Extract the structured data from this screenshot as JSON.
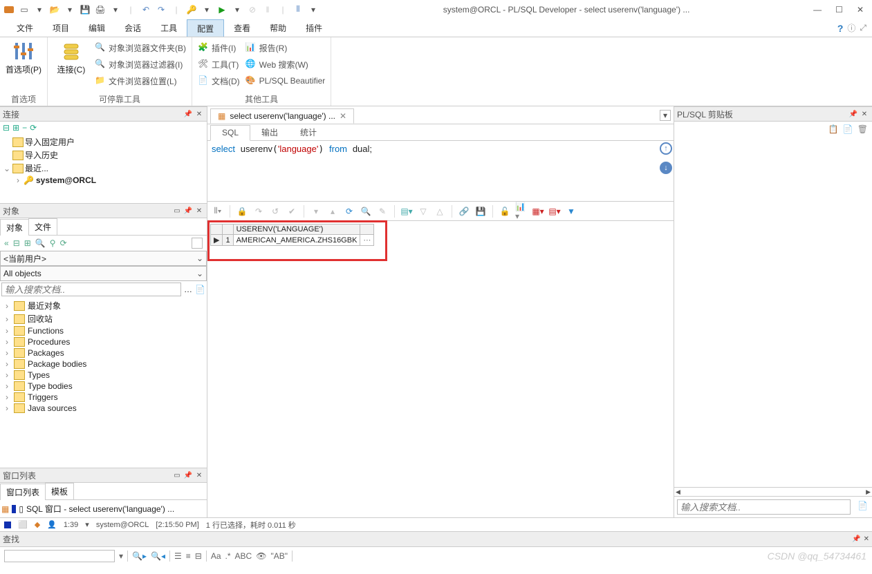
{
  "window": {
    "title": "system@ORCL - PL/SQL Developer - select userenv('language') ..."
  },
  "menu": {
    "items": [
      "文件",
      "项目",
      "编辑",
      "会话",
      "工具",
      "配置",
      "查看",
      "帮助",
      "插件"
    ],
    "active": "配置"
  },
  "ribbon": {
    "group1_label": "首选项",
    "pref_btn": "首选项(P)",
    "group2_label": "可停靠工具",
    "connect_btn": "连接(C)",
    "obj_browser_folder": "对象浏览器文件夹(B)",
    "obj_browser_filter": "对象浏览器过滤器(I)",
    "file_browser_loc": "文件浏览器位置(L)",
    "group3_label": "其他工具",
    "plugin": "插件(I)",
    "tool": "工具(T)",
    "document": "文档(D)",
    "report": "报告(R)",
    "web_search": "Web 搜索(W)",
    "beautifier": "PL/SQL Beautifier"
  },
  "left": {
    "panel_conn": "连接",
    "tree_import_fixed": "导入固定用户",
    "tree_import_hist": "导入历史",
    "tree_recent": "最近...",
    "tree_conn": "system@ORCL",
    "panel_obj": "对象",
    "tab_obj": "对象",
    "tab_file": "文件",
    "current_user": "<当前用户>",
    "all_objects": "All objects",
    "search_ph": "输入搜索文档..",
    "objects": [
      "最近对象",
      "回收站",
      "Functions",
      "Procedures",
      "Packages",
      "Package bodies",
      "Types",
      "Type bodies",
      "Triggers",
      "Java sources"
    ],
    "panel_winlist": "窗口列表",
    "tab_winlist": "窗口列表",
    "tab_template": "模板",
    "winlist_item": "SQL 窗口 - select userenv('language') ..."
  },
  "center": {
    "doc_tab": "select userenv('language') ...",
    "subtabs": {
      "sql": "SQL",
      "output": "输出",
      "stats": "统计"
    },
    "sql": {
      "kw1": "select",
      "fn": "userenv",
      "arg": "'language'",
      "kw2": "from",
      "tbl": "dual",
      "end": ";"
    }
  },
  "grid": {
    "column": "USERENV('LANGUAGE')",
    "value": "AMERICAN_AMERICA.ZHS16GBK",
    "rownum": "1"
  },
  "right": {
    "title": "PL/SQL 剪贴板",
    "search_ph": "输入搜索文档.."
  },
  "status": {
    "cursor": "1:39",
    "conn": "system@ORCL",
    "time": "[2:15:50 PM]",
    "msg": "1 行已选择，耗时 0.011 秒"
  },
  "find": {
    "label": "查找"
  },
  "findtools": {
    "ab1": "ABC",
    "ab2": "\"AB\""
  },
  "watermark": "CSDN @qq_54734461"
}
